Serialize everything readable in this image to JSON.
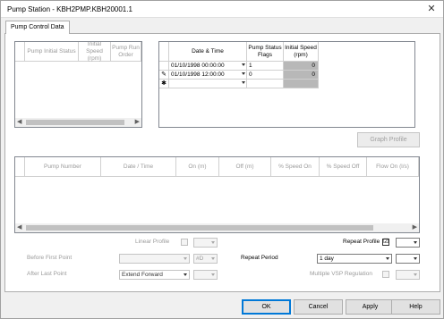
{
  "window": {
    "title": "Pump Station - KBH2PMP.KBH20001.1",
    "close_glyph": "✕"
  },
  "tabs": [
    {
      "label": "Pump Control Data"
    }
  ],
  "initial_grid": {
    "columns": [
      "Pump Initial Status",
      "Initial Speed (rpm)",
      "Pump Run Order"
    ],
    "scroll_left": "◀",
    "scroll_right": "▶"
  },
  "schedule_grid": {
    "columns": [
      "Date & Time",
      "Pump Status Flags",
      "Initial Speed (rpm)"
    ],
    "rows": [
      {
        "marker": "",
        "datetime": "01/10/1998 00:00:00",
        "flags": "1",
        "speed": "0"
      },
      {
        "marker": "✎",
        "datetime": "01/10/1998 12:00:00",
        "flags": "0",
        "speed": "0"
      },
      {
        "marker": "✱",
        "datetime": "",
        "flags": "",
        "speed": ""
      }
    ]
  },
  "graph_profile_button": "Graph Profile",
  "pump_grid": {
    "columns": [
      "Pump Number",
      "Date / Time",
      "On (m)",
      "Off (m)",
      "% Speed On",
      "% Speed Off",
      "Flow On (l/s)"
    ],
    "scroll_left": "◀",
    "scroll_right": "▶"
  },
  "options": {
    "linear_profile_label": "Linear Profile",
    "before_first_point_label": "Before First Point",
    "before_first_point_value": "",
    "before_first_point_aux": "#D",
    "after_last_point_label": "After Last Point",
    "after_last_point_value": "Extend Forward",
    "repeat_profile_label": "Repeat Profile",
    "repeat_profile_checked": "☑",
    "repeat_period_label": "Repeat Period",
    "repeat_period_value": "1 day",
    "multiple_vsp_label": "Multiple VSP Regulation"
  },
  "buttons": {
    "ok": "OK",
    "cancel": "Cancel",
    "apply": "Apply",
    "help": "Help"
  },
  "colors": {
    "accent": "#0078d7",
    "disabled_cell": "#b8b8b8"
  }
}
